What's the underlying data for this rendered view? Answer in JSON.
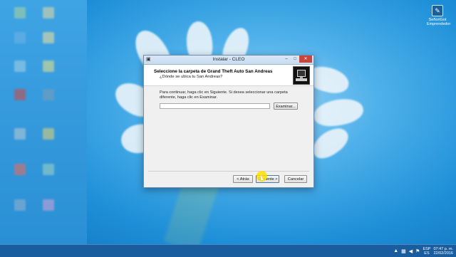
{
  "desktop": {
    "tray_icon_label_line1": "SeñoriGot",
    "tray_icon_label_line2": "Emprendedor"
  },
  "dialog": {
    "title": "Instalar - CLEO",
    "header_title": "Seleccione la carpeta de Grand Theft Auto San Andreas",
    "header_subtitle": "¿Dónde se ubica tu San Andreas?",
    "instructions": "Para continuar, haga clic en Siguiente. Si desea seleccionar una carpeta diferente, haga clic en Examinar.",
    "path_value": "",
    "browse_label": "Examinar...",
    "back_label": "< Atrás",
    "next_label": "Siguiente >",
    "cancel_label": "Cancelar",
    "minimize_glyph": "–",
    "maximize_glyph": "□",
    "close_glyph": "✕"
  },
  "taskbar": {
    "lang_line1": "ESP",
    "lang_line2": "ES",
    "time": "07:47 p. m.",
    "date": "22/02/2016"
  },
  "colors": {
    "accent": "#c7463c",
    "desktop": "#1e8fd6"
  }
}
